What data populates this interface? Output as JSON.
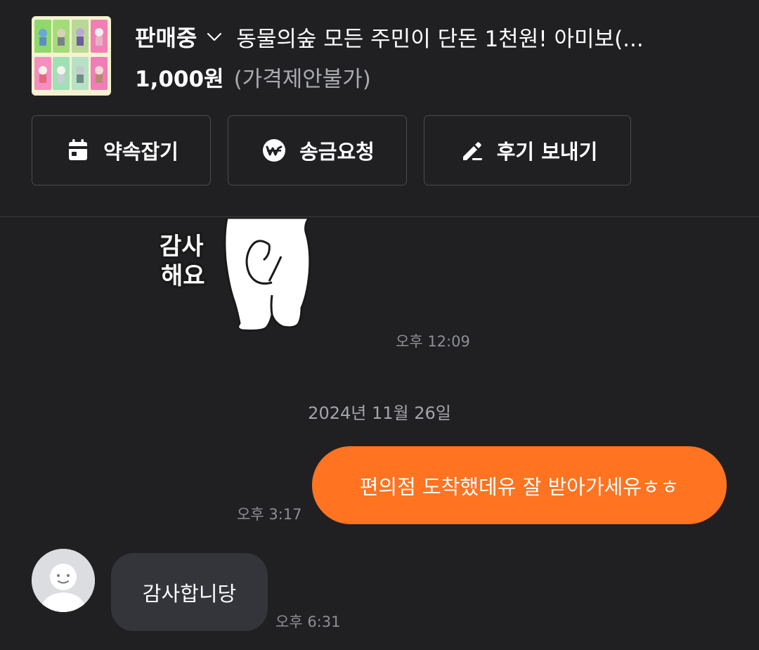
{
  "product": {
    "status": "판매중",
    "title": "동물의숲 모든 주민이 단돈 1천원! 아미보(...",
    "price": "1,000원",
    "price_note": "(가격제안불가)"
  },
  "actions": {
    "appointment": "약속잡기",
    "remit": "송금요청",
    "review": "후기 보내기"
  },
  "icons": {
    "status_dropdown": "chevron-down-icon",
    "appointment": "calendar-icon",
    "remit": "won-coin-icon",
    "review": "pencil-icon",
    "avatar": "default-profile-icon"
  },
  "colors": {
    "background": "#202023",
    "outgoing_bubble": "#ff7321",
    "incoming_bubble": "#34353a"
  },
  "chat": {
    "sticker_text": [
      "감사",
      "해요"
    ],
    "sticker_time": "오후 12:09",
    "date_separator": "2024년 11월 26일",
    "messages": [
      {
        "direction": "outgoing",
        "text": "편의점 도착했데유 잘 받아가세유ㅎㅎ",
        "time": "오후 3:17"
      },
      {
        "direction": "incoming",
        "text": "감사합니당",
        "time": "오후 6:31"
      }
    ]
  }
}
